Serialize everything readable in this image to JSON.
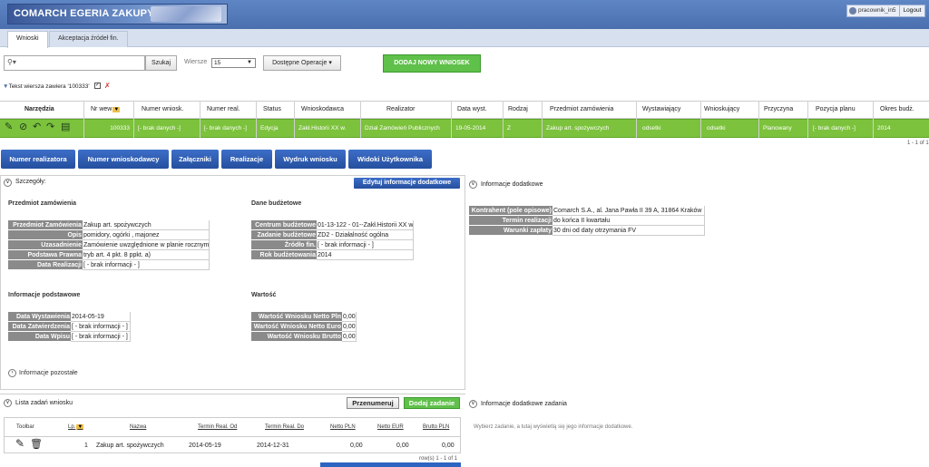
{
  "app": {
    "logo_text": "COMARCH EGERIA ZAKUPY",
    "user": "pracownik_in5",
    "logout": "Logout"
  },
  "tabs": [
    "Wnioski",
    "Akceptacja źródeł fin."
  ],
  "toolbar": {
    "search_btn": "Szukaj",
    "rows_label": "Wiersze",
    "rows_value": "15",
    "ops_btn": "Dostępne Operacje",
    "add_btn": "DODAJ NOWY WNIOSEK"
  },
  "filter": {
    "text": "Tekst wiersza zawiera '100333'"
  },
  "grid": {
    "columns": [
      "Narzędzia",
      "Nr wew",
      "Numer wniosk.",
      "Numer real.",
      "Status",
      "Wnioskodawca",
      "Realizator",
      "Data wyst.",
      "Rodzaj",
      "Przedmiot zamówienia",
      "Wystawiający",
      "Wnioskujący",
      "Przyczyna",
      "Pozycja planu",
      "Okres budż."
    ],
    "row": [
      "100333",
      "[- brak danych -]",
      "[- brak danych -]",
      "Edycja",
      "Zakł.Historii XX w.",
      "Dział Zamówień Publicznych",
      "19-05-2014",
      "Z",
      "Zakup art. spożywczych",
      "odsetki",
      "odsetki",
      "Planowany",
      "[- brak danych -]",
      "2014"
    ],
    "pager": "1 - 1 of 1"
  },
  "bottom_tabs": [
    "Numer realizatora",
    "Numer wnioskodawcy",
    "Załączniki",
    "Realizacje",
    "Wydruk wniosku",
    "Widoki Użytkownika"
  ],
  "details": {
    "title": "Szczegóły:",
    "edit_btn": "Edytuj informacje dodatkowe",
    "przedmiot": {
      "title": "Przedmiot zamówienia",
      "rows": [
        {
          "label": "Przedmiot Zamówienia",
          "value": "Zakup art. spożywczych"
        },
        {
          "label": "Opis",
          "value": "pomidory, ogórki , majonez"
        },
        {
          "label": "Uzasadnienie",
          "value": "Zamówienie uwzględnione w planie rocznym"
        },
        {
          "label": "Podstawa Prawna",
          "value": "tryb art. 4 pkt. 8 ppkt. a)"
        },
        {
          "label": "Data Realizacji",
          "value": "[ - brak informacji - ]"
        }
      ]
    },
    "budzet": {
      "title": "Dane budżetowe",
      "rows": [
        {
          "label": "Centrum budżetowe",
          "value": "01-13-122 - 01--Zakł.Historii XX w."
        },
        {
          "label": "Zadanie budżetowe",
          "value": "ZD2 - Działalność ogólna"
        },
        {
          "label": "Źródło fin.",
          "value": "[ - brak informacji - ]"
        },
        {
          "label": "Rok budżetowania",
          "value": "2014"
        }
      ]
    },
    "podstawowe": {
      "title": "Informacje podstawowe",
      "rows": [
        {
          "label": "Data Wystawienia",
          "value": "2014-05-19"
        },
        {
          "label": "Data Zatwierdzenia",
          "value": "[ - brak informacji - ]"
        },
        {
          "label": "Data Wpisu",
          "value": "[ - brak informacji - ]"
        }
      ]
    },
    "wartosc": {
      "title": "Wartość",
      "rows": [
        {
          "label": "Wartość Wniosku Netto Pln",
          "value": "0,00"
        },
        {
          "label": "Wartość Wniosku Netto Euro",
          "value": "0,00"
        },
        {
          "label": "Wartość Wniosku Brutto",
          "value": "0,00"
        }
      ]
    },
    "pozostale": "Informacje pozostałe"
  },
  "dodatkowe": {
    "title": "Informacje dodatkowe",
    "rows": [
      {
        "label": "Kontrahent (pole opisowe)",
        "value": "Comarch S.A., al. Jana Pawła II 39 A, 31864 Kraków"
      },
      {
        "label": "Termin realizacji",
        "value": "do końca II kwartału"
      },
      {
        "label": "Warunki zapłaty",
        "value": "30 dni od daty otrzymania FV"
      }
    ]
  },
  "tasks": {
    "title": "Lista zadań wniosku",
    "renumber_btn": "Przenumeruj",
    "add_btn": "Dodaj zadanie",
    "columns": [
      "Toolbar",
      "Lp.",
      "Nazwa",
      "Termin Real. Od",
      "Termin Real. Do",
      "Netto PLN",
      "Netto EUR",
      "Brutto PLN"
    ],
    "row": [
      "1",
      "Zakup art. spożywczych",
      "2014-05-19",
      "2014-12-31",
      "0,00",
      "0,00",
      "0,00"
    ],
    "pager": "row(s) 1 - 1 of 1"
  },
  "task_info": {
    "title": "Informacje dodatkowe zadania",
    "hint": "Wybierz zadanie, a tutaj wyświetlą się jego informacje dodatkowe."
  },
  "colors": {
    "header": "#4a6faf",
    "row_selected": "#7cc23c",
    "green_btn": "#5fc04a",
    "blue_btn": "#2b5aae"
  }
}
